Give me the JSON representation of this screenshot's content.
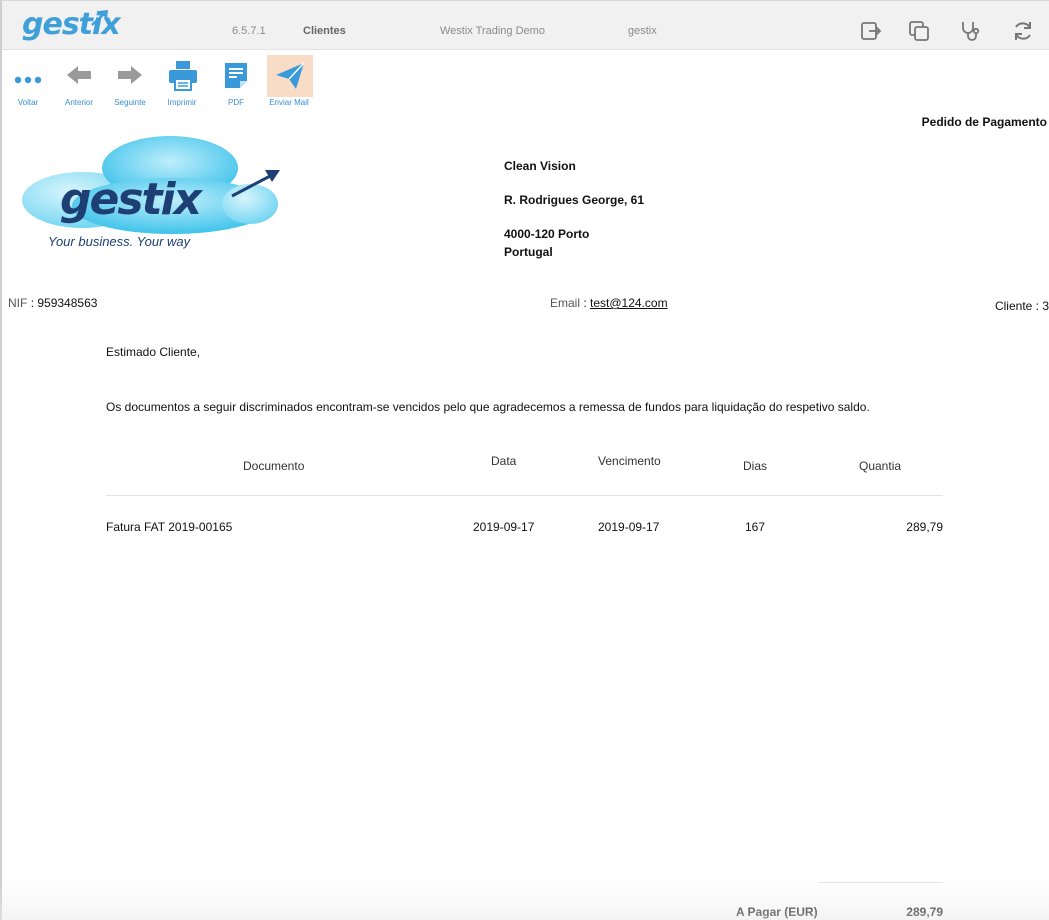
{
  "header": {
    "brand": "gestix",
    "version": "6.5.7.1",
    "module": "Clientes",
    "company": "Westix Trading Demo",
    "user": "gestix",
    "icons": [
      "logout-icon",
      "copy-windows-icon",
      "stethoscope-icon",
      "refresh-icon"
    ]
  },
  "toolbar": {
    "items": [
      {
        "label": "Voltar",
        "icon": "more-dots-icon"
      },
      {
        "label": "Anterior",
        "icon": "arrow-left-icon"
      },
      {
        "label": "Seguinte",
        "icon": "arrow-right-icon"
      },
      {
        "label": "Imprimir",
        "icon": "printer-icon"
      },
      {
        "label": "PDF",
        "icon": "document-icon"
      },
      {
        "label": "Enviar Mail",
        "icon": "send-paper-plane-icon",
        "active": true
      }
    ],
    "accent": "#3a9ad9",
    "active_bg": "#f8dcc6"
  },
  "document": {
    "title": "Pedido de Pagamento",
    "logo": {
      "wordmark": "gestix",
      "tagline": "Your business. Your way"
    },
    "client": {
      "name": "Clean Vision",
      "street": "R. Rodrigues George, 61",
      "city": "4000-120 Porto",
      "country": "Portugal"
    },
    "nif_label": "NIF",
    "nif": "959348563",
    "email_label": "Email",
    "email": "test@124.com",
    "client_label": "Cliente : 3",
    "greeting": "Estimado Cliente,",
    "body": "Os documentos a seguir discriminados encontram-se vencidos pelo que agradecemos a remessa de fundos para liquidação do respetivo saldo.",
    "table": {
      "headers": {
        "documento": "Documento",
        "data": "Data",
        "vencimento": "Vencimento",
        "dias": "Dias",
        "quantia": "Quantia"
      },
      "rows": [
        {
          "documento": "Fatura FAT 2019-00165",
          "data": "2019-09-17",
          "vencimento": "2019-09-17",
          "dias": "167",
          "quantia": "289,79"
        }
      ]
    },
    "total_label": "A Pagar (EUR)",
    "total_value": "289,79"
  }
}
